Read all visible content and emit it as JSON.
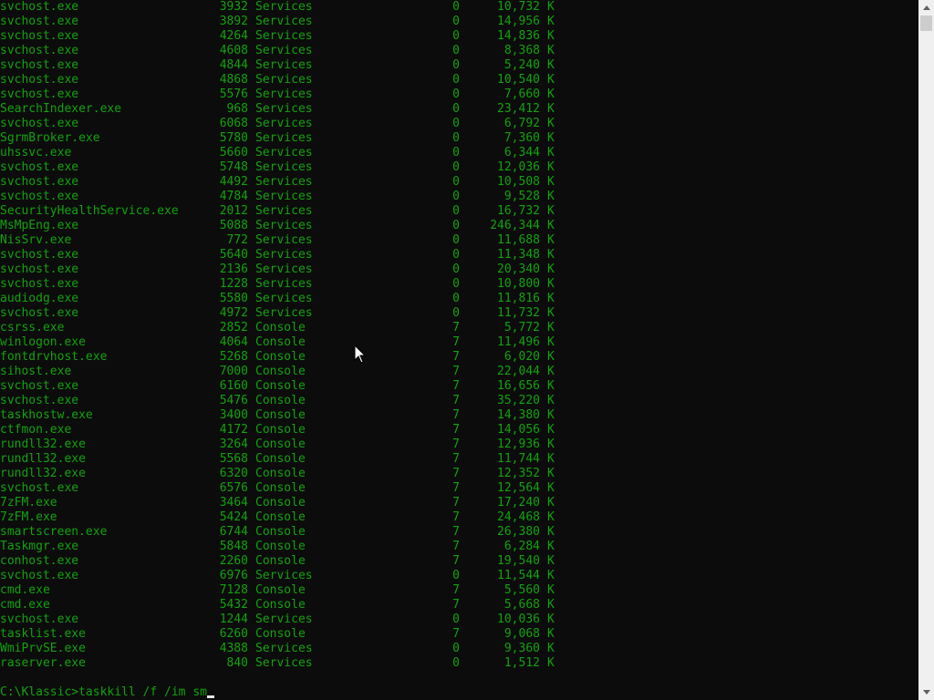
{
  "rows": [
    {
      "name": "svchost.exe",
      "pid": "3932",
      "session": "Services",
      "session_num": "0",
      "mem": "10,732",
      "unit": "K"
    },
    {
      "name": "svchost.exe",
      "pid": "3892",
      "session": "Services",
      "session_num": "0",
      "mem": "14,956",
      "unit": "K"
    },
    {
      "name": "svchost.exe",
      "pid": "4264",
      "session": "Services",
      "session_num": "0",
      "mem": "14,836",
      "unit": "K"
    },
    {
      "name": "svchost.exe",
      "pid": "4608",
      "session": "Services",
      "session_num": "0",
      "mem": "8,368",
      "unit": "K"
    },
    {
      "name": "svchost.exe",
      "pid": "4844",
      "session": "Services",
      "session_num": "0",
      "mem": "5,240",
      "unit": "K"
    },
    {
      "name": "svchost.exe",
      "pid": "4868",
      "session": "Services",
      "session_num": "0",
      "mem": "10,540",
      "unit": "K"
    },
    {
      "name": "svchost.exe",
      "pid": "5576",
      "session": "Services",
      "session_num": "0",
      "mem": "7,660",
      "unit": "K"
    },
    {
      "name": "SearchIndexer.exe",
      "pid": "968",
      "session": "Services",
      "session_num": "0",
      "mem": "23,412",
      "unit": "K"
    },
    {
      "name": "svchost.exe",
      "pid": "6068",
      "session": "Services",
      "session_num": "0",
      "mem": "6,792",
      "unit": "K"
    },
    {
      "name": "SgrmBroker.exe",
      "pid": "5780",
      "session": "Services",
      "session_num": "0",
      "mem": "7,360",
      "unit": "K"
    },
    {
      "name": "uhssvc.exe",
      "pid": "5660",
      "session": "Services",
      "session_num": "0",
      "mem": "6,344",
      "unit": "K"
    },
    {
      "name": "svchost.exe",
      "pid": "5748",
      "session": "Services",
      "session_num": "0",
      "mem": "12,036",
      "unit": "K"
    },
    {
      "name": "svchost.exe",
      "pid": "4492",
      "session": "Services",
      "session_num": "0",
      "mem": "10,508",
      "unit": "K"
    },
    {
      "name": "svchost.exe",
      "pid": "4784",
      "session": "Services",
      "session_num": "0",
      "mem": "9,528",
      "unit": "K"
    },
    {
      "name": "SecurityHealthService.exe",
      "pid": "2012",
      "session": "Services",
      "session_num": "0",
      "mem": "16,732",
      "unit": "K"
    },
    {
      "name": "MsMpEng.exe",
      "pid": "5088",
      "session": "Services",
      "session_num": "0",
      "mem": "246,344",
      "unit": "K"
    },
    {
      "name": "NisSrv.exe",
      "pid": "772",
      "session": "Services",
      "session_num": "0",
      "mem": "11,688",
      "unit": "K"
    },
    {
      "name": "svchost.exe",
      "pid": "5640",
      "session": "Services",
      "session_num": "0",
      "mem": "11,348",
      "unit": "K"
    },
    {
      "name": "svchost.exe",
      "pid": "2136",
      "session": "Services",
      "session_num": "0",
      "mem": "20,340",
      "unit": "K"
    },
    {
      "name": "svchost.exe",
      "pid": "1228",
      "session": "Services",
      "session_num": "0",
      "mem": "10,800",
      "unit": "K"
    },
    {
      "name": "audiodg.exe",
      "pid": "5580",
      "session": "Services",
      "session_num": "0",
      "mem": "11,816",
      "unit": "K"
    },
    {
      "name": "svchost.exe",
      "pid": "4972",
      "session": "Services",
      "session_num": "0",
      "mem": "11,732",
      "unit": "K"
    },
    {
      "name": "csrss.exe",
      "pid": "2852",
      "session": "Console",
      "session_num": "7",
      "mem": "5,772",
      "unit": "K"
    },
    {
      "name": "winlogon.exe",
      "pid": "4064",
      "session": "Console",
      "session_num": "7",
      "mem": "11,496",
      "unit": "K"
    },
    {
      "name": "fontdrvhost.exe",
      "pid": "5268",
      "session": "Console",
      "session_num": "7",
      "mem": "6,020",
      "unit": "K"
    },
    {
      "name": "sihost.exe",
      "pid": "7000",
      "session": "Console",
      "session_num": "7",
      "mem": "22,044",
      "unit": "K"
    },
    {
      "name": "svchost.exe",
      "pid": "6160",
      "session": "Console",
      "session_num": "7",
      "mem": "16,656",
      "unit": "K"
    },
    {
      "name": "svchost.exe",
      "pid": "5476",
      "session": "Console",
      "session_num": "7",
      "mem": "35,220",
      "unit": "K"
    },
    {
      "name": "taskhostw.exe",
      "pid": "3400",
      "session": "Console",
      "session_num": "7",
      "mem": "14,380",
      "unit": "K"
    },
    {
      "name": "ctfmon.exe",
      "pid": "4172",
      "session": "Console",
      "session_num": "7",
      "mem": "14,056",
      "unit": "K"
    },
    {
      "name": "rundll32.exe",
      "pid": "3264",
      "session": "Console",
      "session_num": "7",
      "mem": "12,936",
      "unit": "K"
    },
    {
      "name": "rundll32.exe",
      "pid": "5568",
      "session": "Console",
      "session_num": "7",
      "mem": "11,744",
      "unit": "K"
    },
    {
      "name": "rundll32.exe",
      "pid": "6320",
      "session": "Console",
      "session_num": "7",
      "mem": "12,352",
      "unit": "K"
    },
    {
      "name": "svchost.exe",
      "pid": "6576",
      "session": "Console",
      "session_num": "7",
      "mem": "12,564",
      "unit": "K"
    },
    {
      "name": "7zFM.exe",
      "pid": "3464",
      "session": "Console",
      "session_num": "7",
      "mem": "17,240",
      "unit": "K"
    },
    {
      "name": "7zFM.exe",
      "pid": "5424",
      "session": "Console",
      "session_num": "7",
      "mem": "24,468",
      "unit": "K"
    },
    {
      "name": "smartscreen.exe",
      "pid": "6744",
      "session": "Console",
      "session_num": "7",
      "mem": "26,380",
      "unit": "K"
    },
    {
      "name": "Taskmgr.exe",
      "pid": "5848",
      "session": "Console",
      "session_num": "7",
      "mem": "6,284",
      "unit": "K"
    },
    {
      "name": "conhost.exe",
      "pid": "2260",
      "session": "Console",
      "session_num": "7",
      "mem": "19,540",
      "unit": "K"
    },
    {
      "name": "svchost.exe",
      "pid": "6976",
      "session": "Services",
      "session_num": "0",
      "mem": "11,544",
      "unit": "K"
    },
    {
      "name": "cmd.exe",
      "pid": "7128",
      "session": "Console",
      "session_num": "7",
      "mem": "5,560",
      "unit": "K"
    },
    {
      "name": "cmd.exe",
      "pid": "5432",
      "session": "Console",
      "session_num": "7",
      "mem": "5,668",
      "unit": "K"
    },
    {
      "name": "svchost.exe",
      "pid": "1244",
      "session": "Services",
      "session_num": "0",
      "mem": "10,036",
      "unit": "K"
    },
    {
      "name": "tasklist.exe",
      "pid": "6260",
      "session": "Console",
      "session_num": "7",
      "mem": "9,068",
      "unit": "K"
    },
    {
      "name": "WmiPrvSE.exe",
      "pid": "4388",
      "session": "Services",
      "session_num": "0",
      "mem": "9,360",
      "unit": "K"
    },
    {
      "name": "raserver.exe",
      "pid": "840",
      "session": "Services",
      "session_num": "0",
      "mem": "1,512",
      "unit": "K"
    }
  ],
  "prompt": {
    "path": "C:\\Klassic>",
    "command": "taskkill /f /im sm"
  },
  "colors": {
    "background": "#0c0c0c",
    "text": "#13a10e",
    "cursor": "#e6e6e6",
    "scrollbar_track": "#f0f0f0",
    "scrollbar_thumb": "#cdcdcd"
  },
  "icons": {
    "mouse_pointer": "arrow-cursor-icon",
    "scroll_up": "scroll-up-arrow-icon",
    "scroll_down": "scroll-down-arrow-icon"
  }
}
